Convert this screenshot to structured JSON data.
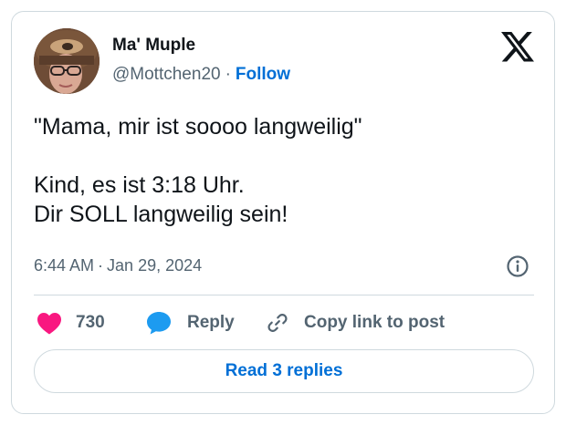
{
  "author": {
    "display_name": "Ma' Muple",
    "handle": "@Mottchen20",
    "separator": "·",
    "follow_label": "Follow",
    "avatar_icon": "avatar-photo"
  },
  "platform_icon": "x-logo-icon",
  "tweet": {
    "lines": [
      "\"Mama, mir ist soooo langweilig\"",
      "",
      "Kind, es ist 3:18 Uhr.",
      "Dir SOLL langweilig sein!"
    ]
  },
  "timestamp": {
    "time": "6:44 AM",
    "separator": "·",
    "date": "Jan 29, 2024"
  },
  "actions": {
    "like_count": "730",
    "reply_label": "Reply",
    "copy_link_label": "Copy link to post"
  },
  "read_replies_label": "Read 3 replies",
  "colors": {
    "text_primary": "#0f1419",
    "text_secondary": "#536471",
    "link_blue": "#006fd6",
    "like_pink": "#f91880",
    "reply_blue": "#1d9bf0",
    "border": "#cfd9de"
  }
}
